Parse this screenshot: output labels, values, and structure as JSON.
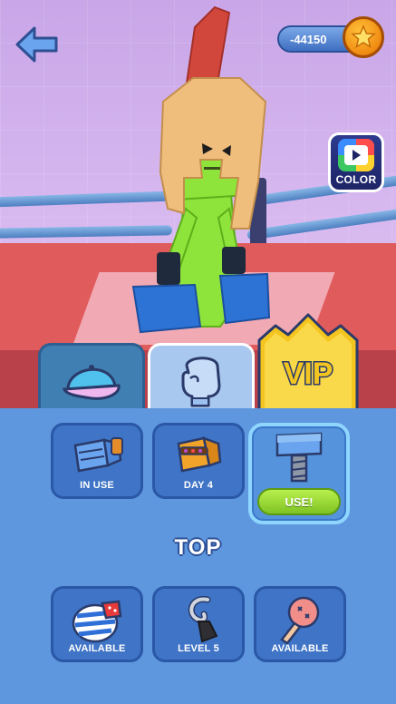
{
  "currency": {
    "amount": "-44150",
    "icon": "star-coin-icon"
  },
  "color_button": {
    "label": "COLOR"
  },
  "tabs": [
    {
      "id": "hats",
      "icon": "cap-icon"
    },
    {
      "id": "gloves",
      "icon": "glove-icon"
    },
    {
      "id": "vip",
      "label": "VIP"
    }
  ],
  "gloves_row": [
    {
      "name": "blue-fist-glove",
      "status": "IN USE"
    },
    {
      "name": "golden-fist-glove",
      "status": "DAY 4"
    },
    {
      "name": "hammer-glove",
      "action": "USE!"
    }
  ],
  "section_title": "TOP",
  "top_row": [
    {
      "name": "striped-glove",
      "status": "AVAILABLE"
    },
    {
      "name": "hook-glove",
      "status": "LEVEL 5"
    },
    {
      "name": "plunger-glove",
      "status": "AVAILABLE"
    }
  ],
  "colors": {
    "panel": "#5e97de",
    "accent_green": "#8fd234",
    "vip_gold": "#f4c51f"
  }
}
